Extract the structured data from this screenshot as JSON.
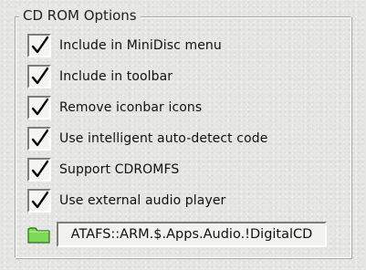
{
  "group_title": "CD ROM Options",
  "options": [
    {
      "label": "Include in MiniDisc menu",
      "checked": true
    },
    {
      "label": "Include in toolbar",
      "checked": true
    },
    {
      "label": "Remove iconbar icons",
      "checked": true
    },
    {
      "label": "Use intelligent auto-detect code",
      "checked": true
    },
    {
      "label": "Support CDROMFS",
      "checked": true
    },
    {
      "label": "Use external audio player",
      "checked": true
    }
  ],
  "path_field": {
    "value": "ATAFS::ARM.$.Apps.Audio.!DigitalCD",
    "icon": "folder-icon",
    "icon_color": "#7ed957"
  }
}
